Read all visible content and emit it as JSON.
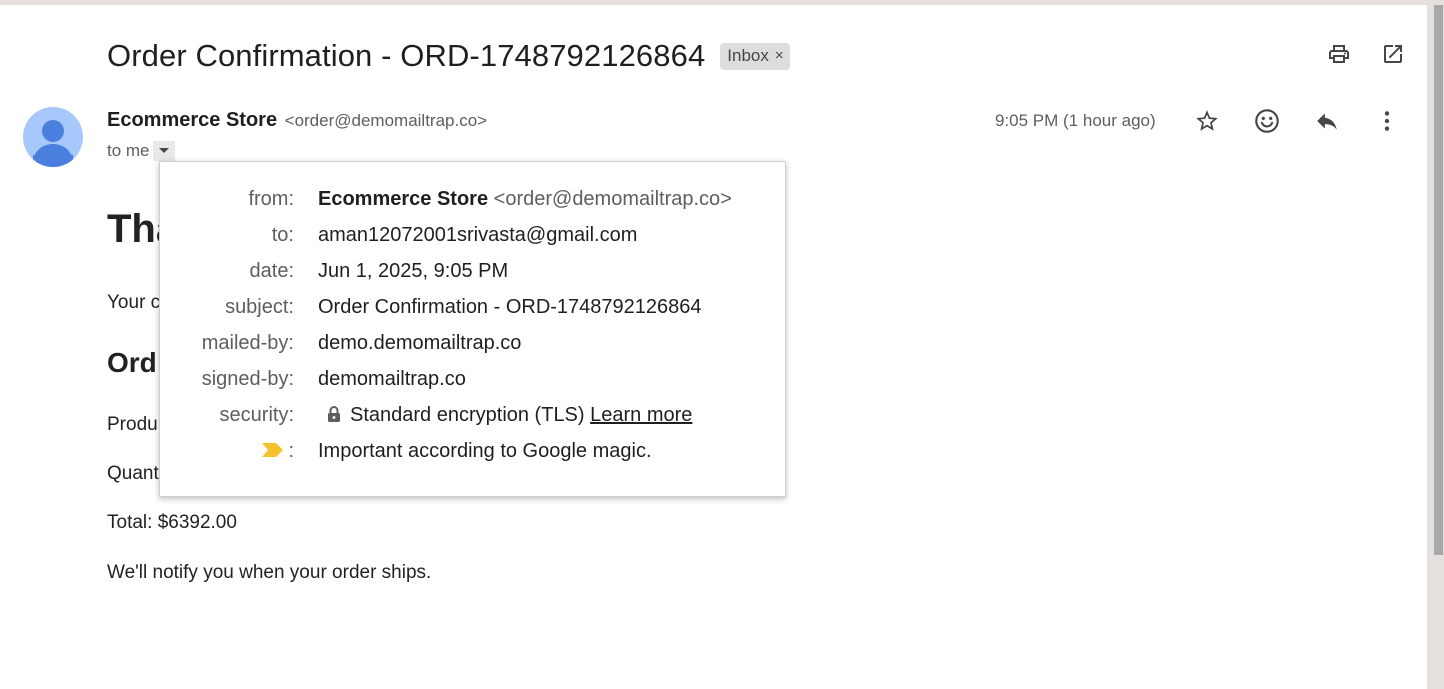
{
  "email": {
    "subject": "Order Confirmation - ORD-1748792126864",
    "label": "Inbox",
    "label_close": "×",
    "sender_name": "Ecommerce Store",
    "sender_email": "<order@demomailtrap.co>",
    "recipient_summary": "to me",
    "time": "9:05 PM (1 hour ago)"
  },
  "body": {
    "heading_partial": "Tha",
    "line1_partial": "Your c",
    "section_heading_partial": "Ord",
    "product_partial": "Produ",
    "quantity_partial": "Quant",
    "total": "Total: $6392.00",
    "notify": "We'll notify you when your order ships."
  },
  "details_popup": {
    "from_label": "from:",
    "from_name": "Ecommerce Store",
    "from_email": "<order@demomailtrap.co>",
    "to_label": "to:",
    "to_value": "aman12072001srivasta@gmail.com",
    "date_label": "date:",
    "date_value": "Jun 1, 2025, 9:05 PM",
    "subject_label": "subject:",
    "subject_value": "Order Confirmation - ORD-1748792126864",
    "mailed_by_label": "mailed-by:",
    "mailed_by_value": "demo.demomailtrap.co",
    "signed_by_label": "signed-by:",
    "signed_by_value": "demomailtrap.co",
    "security_label": "security:",
    "security_value": "Standard encryption (TLS)",
    "security_link": "Learn more",
    "importance_colon": ":",
    "importance_value": "Important according to Google magic."
  },
  "icons": {
    "print": "print-icon",
    "open_new_window": "open-in-new-window-icon",
    "star": "star-icon",
    "emoji": "emoji-icon",
    "reply": "reply-icon",
    "more": "more-vert-icon",
    "dropdown": "arrow-drop-down-icon",
    "lock": "lock-icon",
    "importance": "importance-marker-icon"
  },
  "colors": {
    "avatar_bg": "#a8c7fa",
    "avatar_fg": "#4a7fe0",
    "importance_marker": "#f4c22b"
  }
}
